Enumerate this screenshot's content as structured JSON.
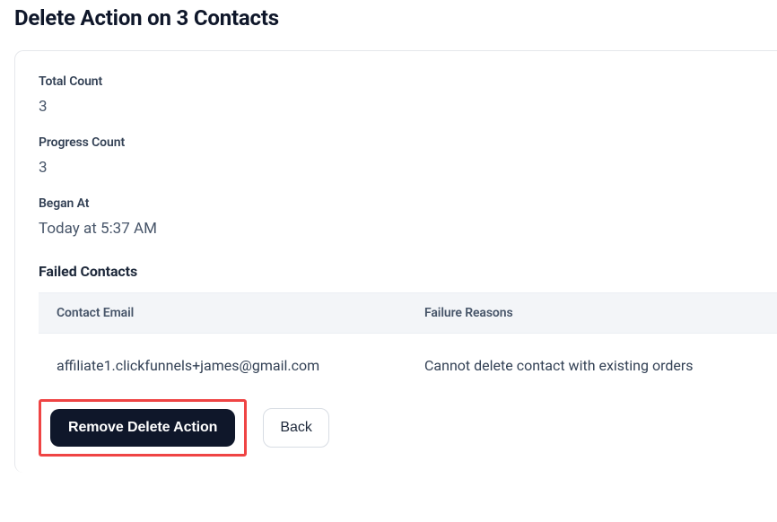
{
  "page": {
    "title": "Delete Action on 3 Contacts"
  },
  "fields": {
    "total_count_label": "Total Count",
    "total_count_value": "3",
    "progress_count_label": "Progress Count",
    "progress_count_value": "3",
    "began_at_label": "Began At",
    "began_at_value": "Today at 5:37 AM"
  },
  "failed": {
    "heading": "Failed Contacts",
    "columns": {
      "email": "Contact Email",
      "reason": "Failure Reasons"
    },
    "rows": [
      {
        "email": "affiliate1.clickfunnels+james@gmail.com",
        "reason": "Cannot delete contact with existing orders"
      }
    ]
  },
  "actions": {
    "remove_label": "Remove Delete Action",
    "back_label": "Back"
  }
}
